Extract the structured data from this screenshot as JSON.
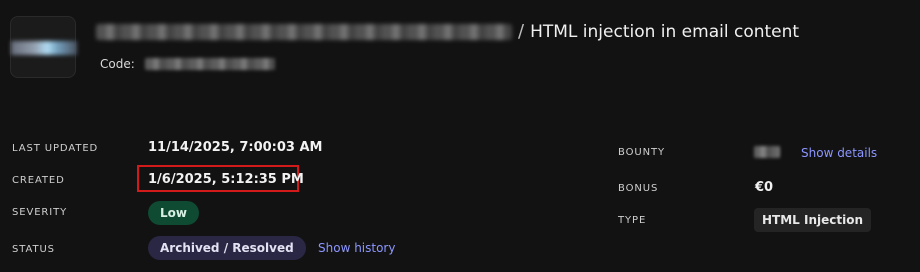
{
  "header": {
    "breadcrumb_separator": "/",
    "current_page_title": "HTML injection in email content",
    "code_label": "Code:"
  },
  "details": {
    "last_updated": {
      "label": "LAST UPDATED",
      "value": "11/14/2025, 7:00:03 AM"
    },
    "created": {
      "label": "CREATED",
      "value": "1/6/2025, 5:12:35 PM"
    },
    "severity": {
      "label": "SEVERITY",
      "value": "Low"
    },
    "status": {
      "label": "STATUS",
      "value": "Archived / Resolved",
      "history_link": "Show history"
    }
  },
  "meta": {
    "bounty": {
      "label": "BOUNTY",
      "details_link": "Show details"
    },
    "bonus": {
      "label": "BONUS",
      "value": "€0"
    },
    "type": {
      "label": "TYPE",
      "value": "HTML Injection"
    }
  },
  "colors": {
    "background": "#121212",
    "link": "#8c96ff",
    "severity_pill": "#0f4a33",
    "status_pill": "#2a2744",
    "highlight_box": "#d31a1a"
  }
}
